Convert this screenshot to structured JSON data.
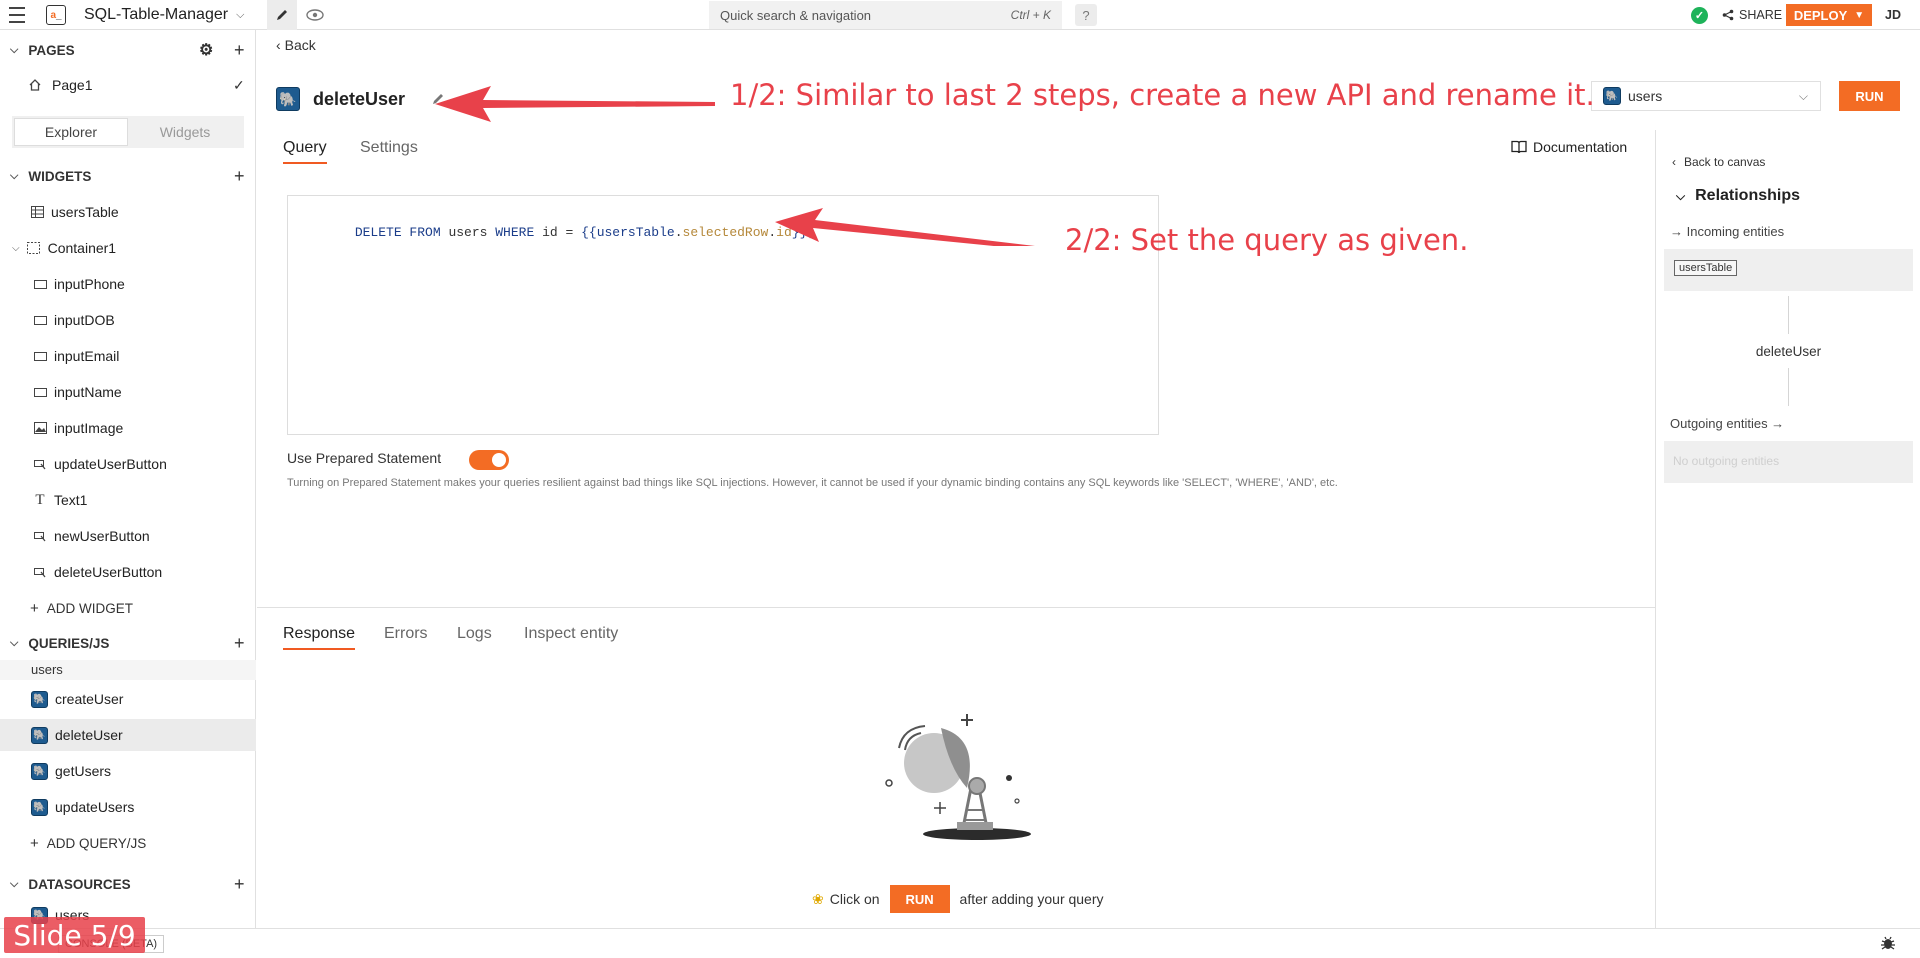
{
  "header": {
    "app_name": "SQL-Table-Manager",
    "search_placeholder": "Quick search & navigation",
    "search_shortcut": "Ctrl + K",
    "help": "?",
    "share": "SHARE",
    "deploy": "DEPLOY",
    "user_initials": "JD"
  },
  "sidebar": {
    "pages_title": "PAGES",
    "pages": [
      {
        "label": "Page1"
      }
    ],
    "explorer_tab": "Explorer",
    "widgets_tab": "Widgets",
    "widgets_title": "WIDGETS",
    "widgets": [
      {
        "label": "usersTable",
        "icon": "table-icon"
      },
      {
        "label": "Container1",
        "icon": "container-icon"
      },
      {
        "label": "inputPhone",
        "icon": "input-icon"
      },
      {
        "label": "inputDOB",
        "icon": "input-icon"
      },
      {
        "label": "inputEmail",
        "icon": "input-icon"
      },
      {
        "label": "inputName",
        "icon": "input-icon"
      },
      {
        "label": "inputImage",
        "icon": "image-icon"
      },
      {
        "label": "updateUserButton",
        "icon": "button-icon"
      },
      {
        "label": "Text1",
        "icon": "text-icon"
      },
      {
        "label": "newUserButton",
        "icon": "button-icon"
      },
      {
        "label": "deleteUserButton",
        "icon": "button-icon"
      }
    ],
    "add_widget": "ADD WIDGET",
    "queries_title": "QUERIES/JS",
    "queries_group": "users",
    "queries": [
      {
        "label": "createUser"
      },
      {
        "label": "deleteUser"
      },
      {
        "label": "getUsers"
      },
      {
        "label": "updateUsers"
      }
    ],
    "add_query": "ADD QUERY/JS",
    "datasources_title": "DATASOURCES",
    "datasource": "users"
  },
  "editor": {
    "back": "Back",
    "query_name": "deleteUser",
    "datasource_select": "users",
    "run": "RUN",
    "tabs": [
      "Query",
      "Settings"
    ],
    "documentation": "Documentation",
    "query_code": {
      "p1": "DELETE FROM",
      "p2": " users ",
      "p3": "WHERE",
      "p4": " id = ",
      "p5": "{{",
      "p6": "usersTable",
      "p7": ".",
      "p8": "selectedRow",
      "p9": ".",
      "p10": "id",
      "p11": "}}",
      "p12": ";"
    },
    "prepared_label": "Use Prepared Statement",
    "prepared_on": true,
    "prepared_help": "Turning on Prepared Statement makes your queries resilient against bad things like SQL injections. However, it cannot be used if your dynamic binding contains any SQL keywords like 'SELECT', 'WHERE', 'AND', etc."
  },
  "response": {
    "tabs": [
      "Response",
      "Errors",
      "Logs",
      "Inspect entity"
    ],
    "hint_prefix": "Click on",
    "hint_button": "RUN",
    "hint_suffix": "after adding your query"
  },
  "relationships": {
    "back_to_canvas": "Back to canvas",
    "title": "Relationships",
    "incoming_label": "→ Incoming entities",
    "incoming": [
      "usersTable"
    ],
    "current": "deleteUser",
    "outgoing_label": "Outgoing entities →",
    "outgoing_empty": "No outgoing entities"
  },
  "statusbar": {
    "console": "CONSOLE (BETA)"
  },
  "annotations": {
    "step1": "1/2: Similar to last 2 steps, create a new API and rename it.",
    "step2": "2/2: Set the query as given.",
    "slide": "Slide 5/9"
  },
  "colors": {
    "accent": "#f36c24",
    "annotation": "#e8414a",
    "success": "#1eb35a"
  }
}
